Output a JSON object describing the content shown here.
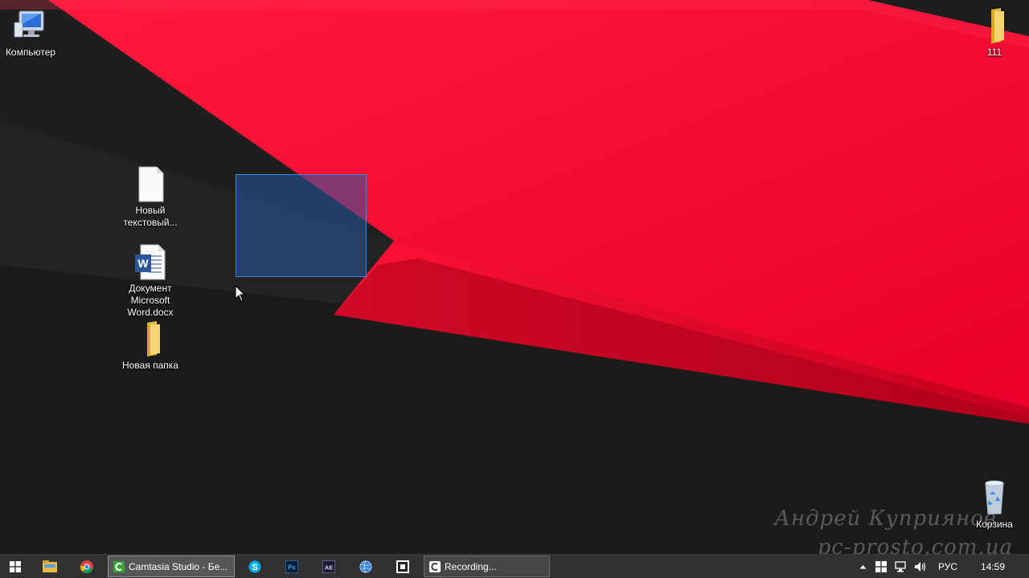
{
  "desktop": {
    "icons": {
      "computer": "Компьютер",
      "folder_111": "111",
      "text_file": "Новый текстовый...",
      "word_doc": "Документ Microsoft Word.docx",
      "new_folder": "Новая папка",
      "recycle_bin": "Корзина"
    },
    "watermark": {
      "line1": "Андрей Куприянов",
      "line2": "pc-prosto.com.ua"
    }
  },
  "taskbar": {
    "apps": [
      {
        "icon": "windows-start-icon"
      },
      {
        "icon": "file-explorer-icon"
      },
      {
        "icon": "chrome-icon"
      },
      {
        "icon": "camtasia-icon",
        "label": "Camtasia Studio - Бе..."
      },
      {
        "icon": "skype-icon"
      },
      {
        "icon": "photoshop-icon",
        "text": "Ps"
      },
      {
        "icon": "after-effects-icon",
        "text": "AE"
      },
      {
        "icon": "internet-icon"
      },
      {
        "icon": "camtasia-recorder-icon"
      },
      {
        "icon": "camtasia-icon",
        "label": "Recording..."
      }
    ],
    "tray": {
      "language": "РУС",
      "time": "14:59"
    }
  },
  "colors": {
    "accent_red": "#ff0a32",
    "dark_background": "#1b1b1c",
    "selection_fill": "#285aa0",
    "selection_border": "#3a87e0"
  }
}
